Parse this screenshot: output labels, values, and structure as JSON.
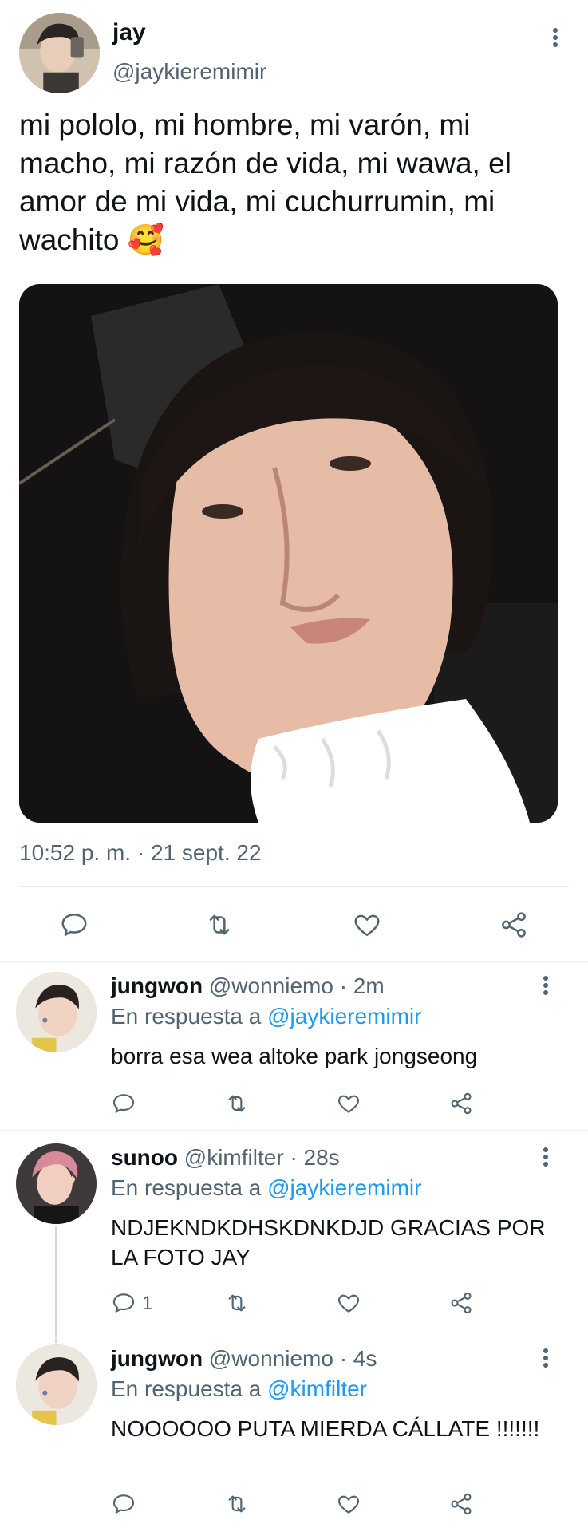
{
  "main_tweet": {
    "author_name": "jay",
    "author_handle": "@jaykieremimir",
    "text": "mi pololo, mi hombre, mi varón, mi macho, mi razón de vida, mi wawa, el amor de mi vida, mi cuchurrumin, mi wachito 🥰",
    "timestamp": "10:52 p. m. · 21 sept. 22",
    "actions": [
      "reply-icon",
      "retweet-icon",
      "like-icon",
      "share-icon"
    ]
  },
  "replies": [
    {
      "author_name": "jungwon",
      "author_handle": "@wonniemo",
      "time": "· 2m",
      "in_reply_prefix": "En respuesta a",
      "in_reply_to": "@jaykieremimir",
      "text": "borra esa wea altoke park jongseong",
      "reply_count": ""
    },
    {
      "author_name": "sunoo",
      "author_handle": "@kimfilter",
      "time": "· 28s",
      "in_reply_prefix": "En respuesta a",
      "in_reply_to": "@jaykieremimir",
      "text": "NDJEKNDKDHSKDNKDJD GRACIAS POR LA FOTO JAY",
      "reply_count": "1"
    },
    {
      "author_name": "jungwon",
      "author_handle": "@wonniemo",
      "time": "· 4s",
      "in_reply_prefix": "En respuesta a",
      "in_reply_to": "@kimfilter",
      "text": "NOOOOOO PUTA MIERDA CÁLLATE !!!!!!!",
      "reply_count": ""
    }
  ],
  "colors": {
    "text": "#0f1419",
    "secondary": "#536471",
    "link": "#1d9bf0",
    "divider": "#eff3f4"
  }
}
